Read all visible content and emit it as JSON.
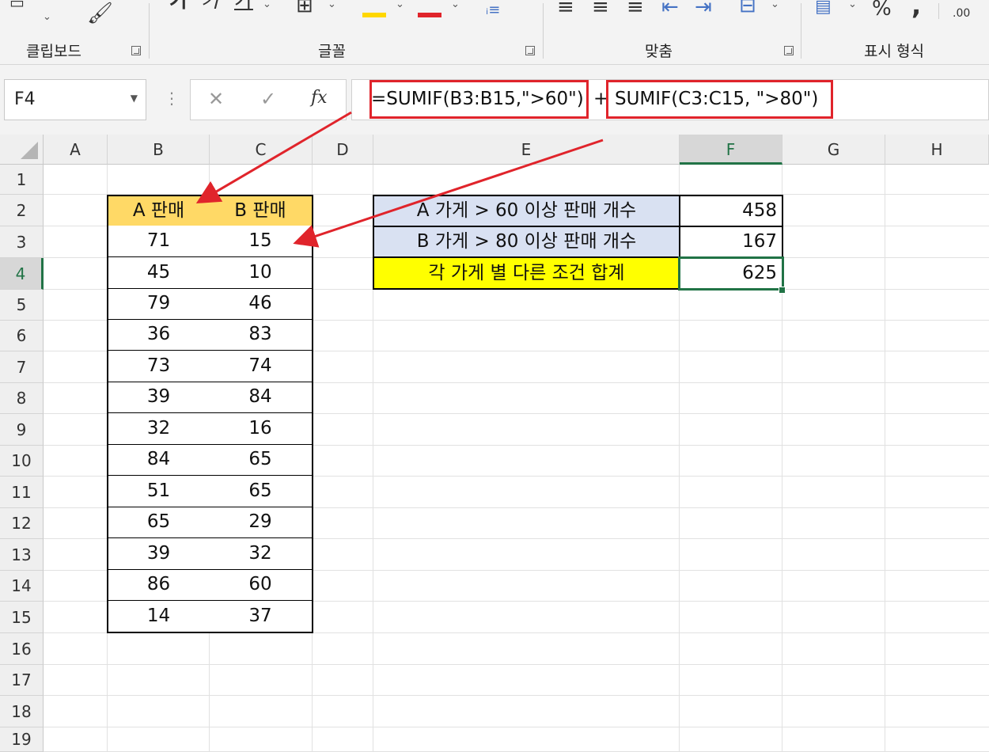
{
  "ribbon": {
    "groups": [
      {
        "label": "클립보드"
      },
      {
        "label": "글꼴"
      },
      {
        "label": "맞춤"
      },
      {
        "label": "표시 형식"
      }
    ],
    "percent_symbol": "%",
    "comma_symbol": ",",
    "decimal_label": ".00",
    "font_color": "#e0242b",
    "highlight_color": "#ffd700"
  },
  "formula_bar": {
    "name_box": "F4",
    "cancel_glyph": "✕",
    "enter_glyph": "✓",
    "fx_label": "fx",
    "formula_part1": "=SUMIF(B3:B15,\">60\")",
    "formula_plus": "+",
    "formula_part2": "SUMIF(C3:C15, \">80\")"
  },
  "columns": [
    "A",
    "B",
    "C",
    "D",
    "E",
    "F",
    "G",
    "H"
  ],
  "rows": [
    "1",
    "2",
    "3",
    "4",
    "5",
    "6",
    "7",
    "8",
    "9",
    "10",
    "11",
    "12",
    "13",
    "14",
    "15",
    "16",
    "17",
    "18",
    "19"
  ],
  "table": {
    "headers": [
      "A 판매",
      "B 판매"
    ],
    "rows": [
      [
        "71",
        "15"
      ],
      [
        "45",
        "10"
      ],
      [
        "79",
        "46"
      ],
      [
        "36",
        "83"
      ],
      [
        "73",
        "74"
      ],
      [
        "39",
        "84"
      ],
      [
        "32",
        "16"
      ],
      [
        "84",
        "65"
      ],
      [
        "51",
        "65"
      ],
      [
        "65",
        "29"
      ],
      [
        "39",
        "32"
      ],
      [
        "86",
        "60"
      ],
      [
        "14",
        "37"
      ]
    ]
  },
  "summary": [
    {
      "label": "A 가게 > 60 이상 판매 개수",
      "value": "458"
    },
    {
      "label": "B 가게 > 80 이상 판매 개수",
      "value": "167"
    },
    {
      "label": "각 가게 별 다른 조건 합계",
      "value": "625"
    }
  ],
  "colors": {
    "header_fill": "#ffd966",
    "label_fill": "#d9e1f2",
    "total_fill": "#ffff00",
    "selection": "#217346",
    "annotation": "#e0242b"
  }
}
